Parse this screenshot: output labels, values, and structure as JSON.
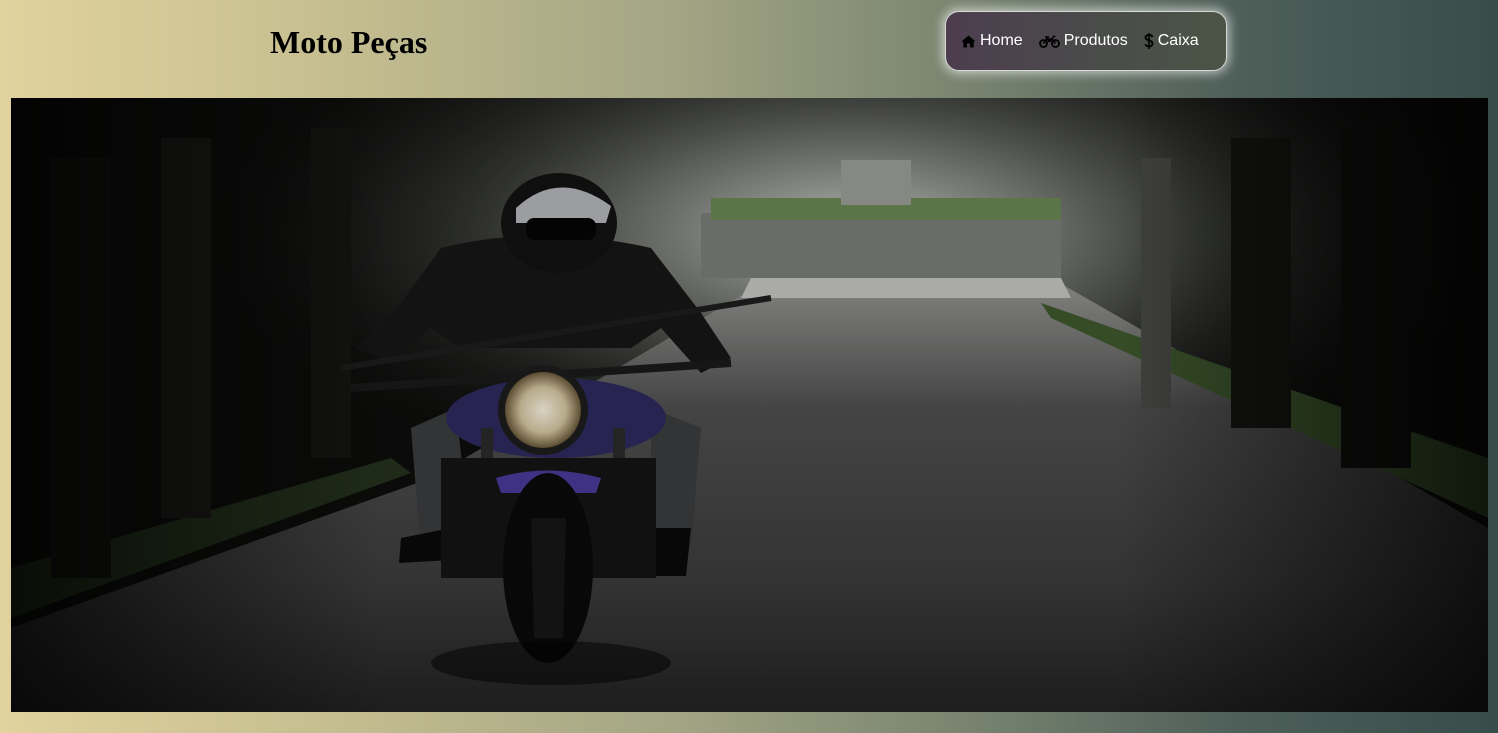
{
  "header": {
    "title": "Moto Peças"
  },
  "nav": {
    "items": [
      {
        "label": "Home",
        "icon": "home-icon"
      },
      {
        "label": "Produtos",
        "icon": "motorcycle-icon"
      },
      {
        "label": "Caixa",
        "icon": "dollar-icon"
      }
    ]
  },
  "hero": {
    "image": "motorcycle-rider-on-forest-road-photo"
  },
  "colors": {
    "background_start": "#e1d29e",
    "background_end": "#384c4a",
    "nav_background": "#4a4c4a",
    "nav_text": "#ffffff"
  }
}
